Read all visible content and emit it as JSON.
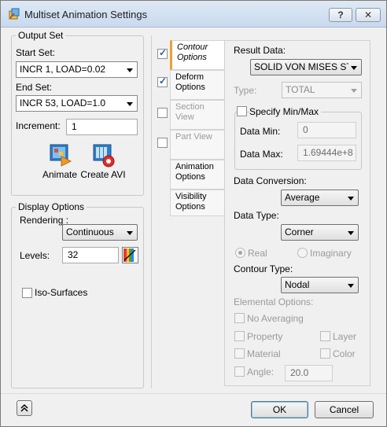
{
  "window": {
    "title": "Multiset Animation Settings",
    "help_label": "?",
    "close_label": "✕"
  },
  "output_set": {
    "group_title": "Output Set",
    "start_label": "Start Set:",
    "start_value": "INCR 1, LOAD=0.02",
    "end_label": "End Set:",
    "end_value": "INCR 53, LOAD=1.0",
    "increment_label": "Increment:",
    "increment_value": "1",
    "animate_label": "Animate",
    "create_avi_label": "Create AVI"
  },
  "display_options": {
    "group_title": "Display Options",
    "rendering_label": "Rendering :",
    "rendering_value": "Continuous",
    "levels_label": "Levels:",
    "levels_value": "32",
    "iso_label": "Iso-Surfaces"
  },
  "tabs": [
    {
      "label": "Contour Options",
      "checked": true
    },
    {
      "label": "Deform Options",
      "checked": true
    },
    {
      "label": "Section View",
      "checked": false
    },
    {
      "label": "Part View",
      "checked": false
    },
    {
      "label": "Animation Options"
    },
    {
      "label": "Visibility Options"
    }
  ],
  "contour": {
    "result_data_label": "Result Data:",
    "result_data_value": "SOLID VON MISES STRES",
    "type_label": "Type:",
    "type_value": "TOTAL",
    "specify_minmax_label": "Specify Min/Max",
    "data_min_label": "Data Min:",
    "data_min_value": "0",
    "data_max_label": "Data Max:",
    "data_max_value": "1.69444e+8",
    "conversion_label": "Data Conversion:",
    "conversion_value": "Average",
    "data_type_label": "Data Type:",
    "data_type_value": "Corner",
    "real_label": "Real",
    "imaginary_label": "Imaginary",
    "contour_type_label": "Contour Type:",
    "contour_type_value": "Nodal",
    "elemental_label": "Elemental Options:",
    "no_averaging_label": "No Averaging",
    "property_label": "Property",
    "layer_label": "Layer",
    "material_label": "Material",
    "color_label": "Color",
    "angle_label": "Angle:",
    "angle_value": "20.0"
  },
  "footer": {
    "ok_label": "OK",
    "cancel_label": "Cancel"
  }
}
